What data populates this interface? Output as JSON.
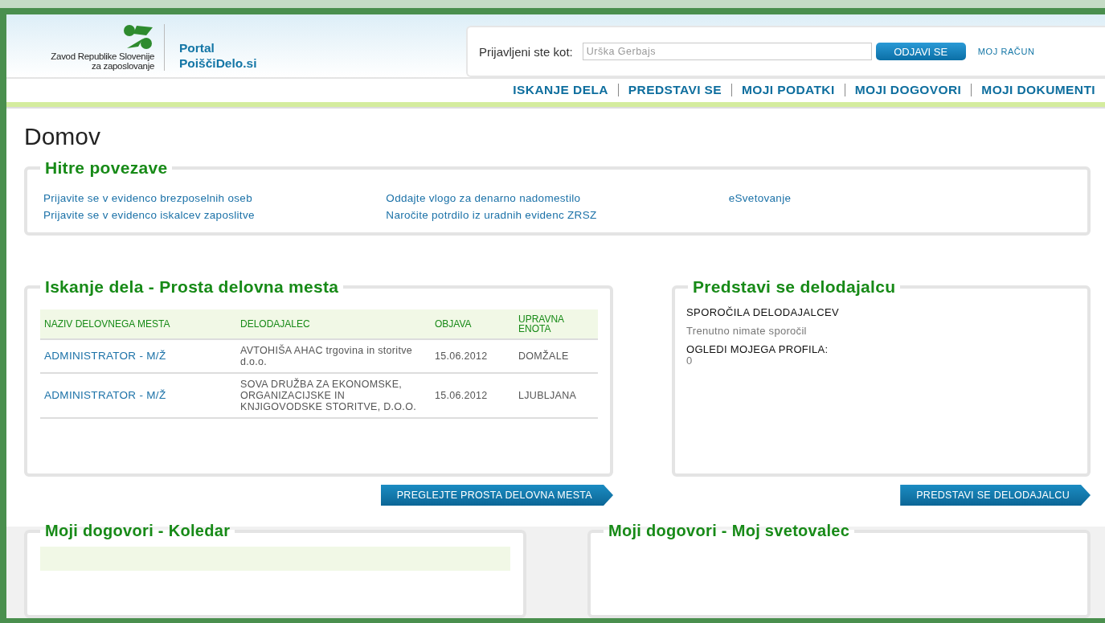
{
  "logo": {
    "org_line1": "Zavod Republike Slovenije",
    "org_line2": "za zaposlovanje",
    "portal_line1": "Portal",
    "portal_line2": "PoiščiDelo.si"
  },
  "login": {
    "label": "Prijavljeni ste kot:",
    "user": "Urška Gerbajs",
    "logout_button": "ODJAVI SE",
    "account_link": "MOJ RAČUN"
  },
  "nav": [
    "ISKANJE DELA",
    "PREDSTAVI SE",
    "MOJI PODATKI",
    "MOJI DOGOVORI",
    "MOJI DOKUMENTI"
  ],
  "page_title": "Domov",
  "quick_links": {
    "title": "Hitre povezave",
    "columns": [
      [
        "Prijavite se v evidenco brezposelnih oseb",
        "Prijavite se v evidenco iskalcev zaposlitve"
      ],
      [
        "Oddajte vlogo za denarno nadomestilo",
        "Naročite potrdilo iz uradnih evidenc ZRSZ"
      ],
      [
        "eSvetovanje"
      ]
    ]
  },
  "jobs": {
    "title": "Iskanje dela - Prosta delovna mesta",
    "columns": [
      "NAZIV DELOVNEGA MESTA",
      "DELODAJALEC",
      "OBJAVA",
      "UPRAVNA ENOTA"
    ],
    "rows": [
      {
        "title": "ADMINISTRATOR - M/Ž",
        "employer": "AVTOHIŠA AHAC trgovina in storitve d.o.o.",
        "date": "15.06.2012",
        "unit": "DOMŽALE"
      },
      {
        "title": "ADMINISTRATOR - M/Ž",
        "employer": "SOVA DRUŽBA ZA EKONOMSKE, ORGANIZACIJSKE IN KNJIGOVODSKE STORITVE, D.O.O.",
        "date": "15.06.2012",
        "unit": "LJUBLJANA"
      }
    ],
    "button": "PREGLEJTE PROSTA DELOVNA MESTA"
  },
  "employer_panel": {
    "title": "Predstavi se delodajalcu",
    "messages_heading": "SPOROČILA DELODAJALCEV",
    "messages_text": "Trenutno nimate sporočil",
    "views_heading": "OGLEDI MOJEGA PROFILA:",
    "views_count": "0",
    "button": "PREDSTAVI SE DELODAJALCU"
  },
  "calendar": {
    "title": "Moji dogovori - Koledar"
  },
  "advisor": {
    "title": "Moji dogovori - Moj svetovalec"
  }
}
